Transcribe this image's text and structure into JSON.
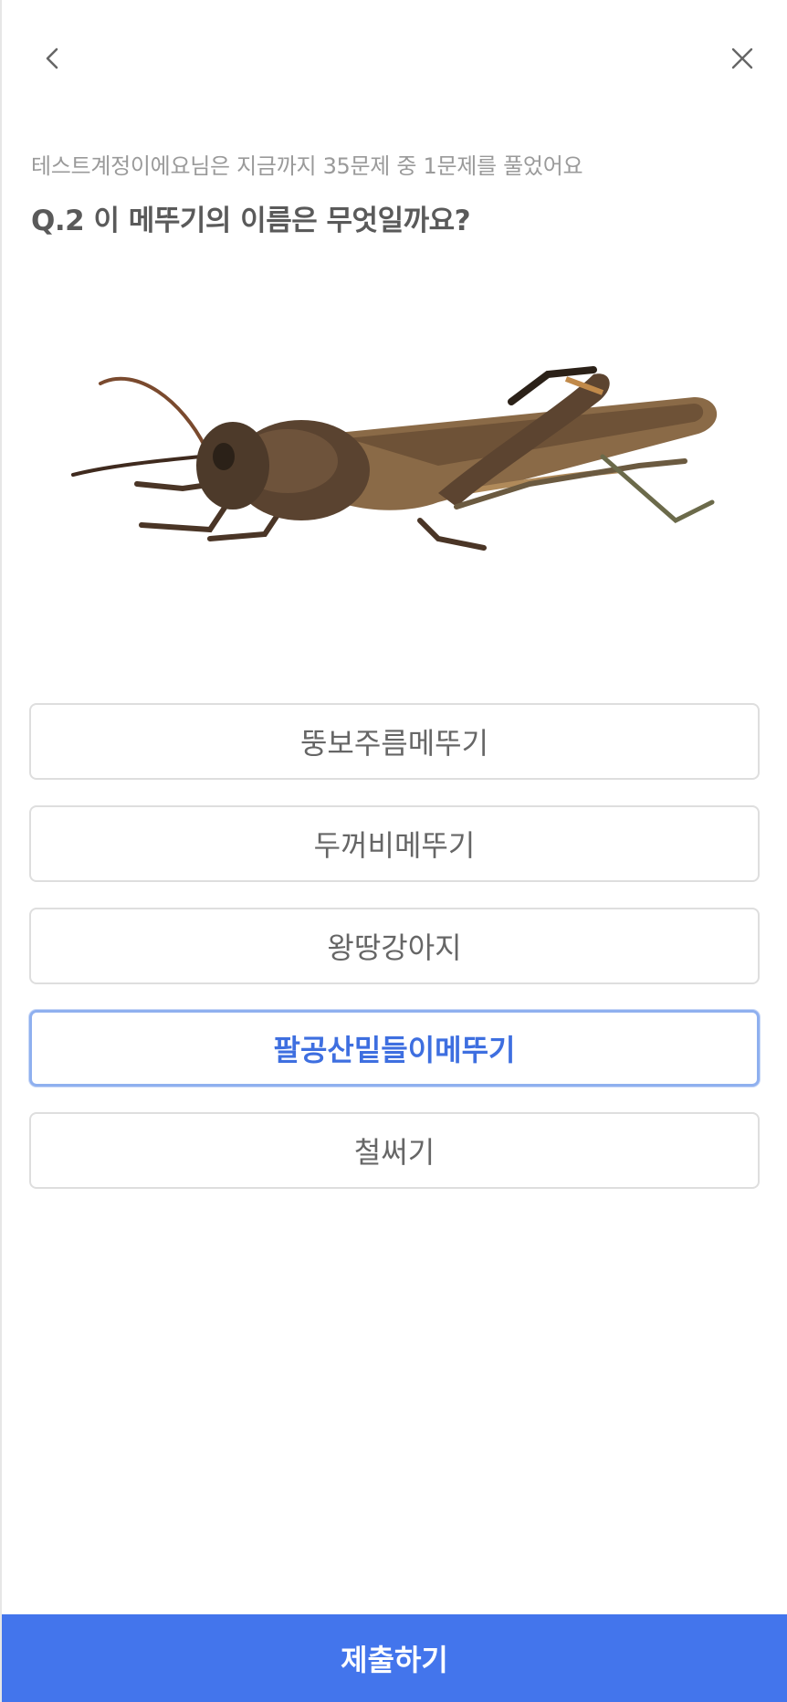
{
  "header": {
    "back_icon": "chevron-left-icon",
    "close_icon": "close-icon"
  },
  "quiz": {
    "progress_text": "테스트계정이에요님은 지금까지 35문제 중 1문제를 풀었어요",
    "question": "Q.2 이 메뚜기의 이름은 무엇일까요?",
    "choices": [
      "뚱보주름메뚜기",
      "두꺼비메뚜기",
      "왕땅강아지",
      "팔공산밑들이메뚜기",
      "철써기"
    ],
    "selected_choice": "팔공산밑들이메뚜기"
  },
  "footer": {
    "submit_label": "제출하기"
  },
  "colors": {
    "accent": "#4375ec",
    "selected_text": "#3e6fe0",
    "selected_border": "#8fb0ef"
  }
}
